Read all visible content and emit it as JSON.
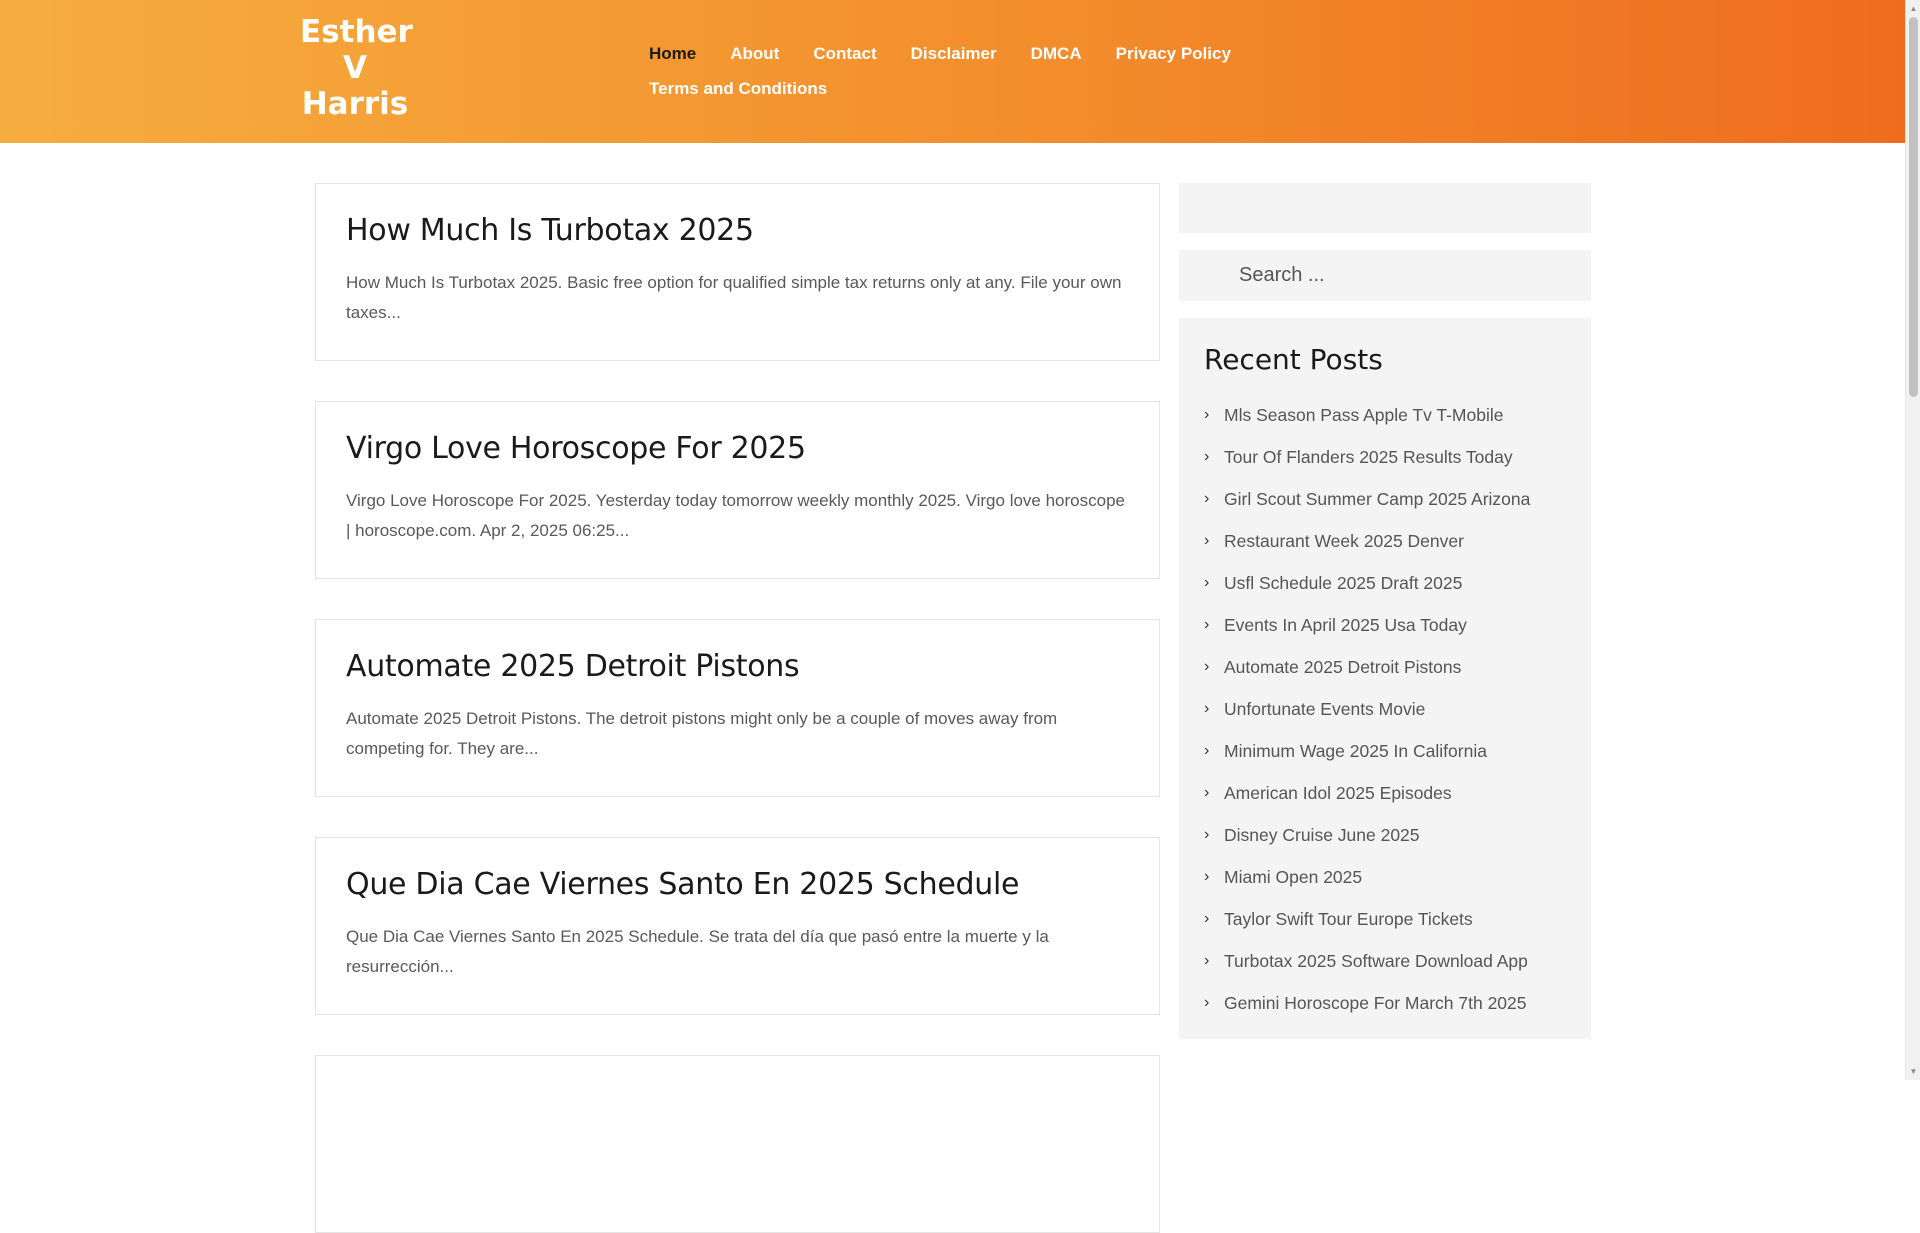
{
  "site": {
    "brand_lines": [
      "Esther",
      "V",
      "Harris"
    ]
  },
  "nav": {
    "row1": [
      "Home",
      "About",
      "Contact",
      "Disclaimer",
      "DMCA",
      "Privacy Policy"
    ],
    "row2": [
      "Terms and Conditions"
    ],
    "active": "Home"
  },
  "posts": [
    {
      "title": "How Much Is Turbotax 2025",
      "excerpt": "How Much Is Turbotax 2025. Basic free option for qualified simple tax returns only at any. File your own taxes..."
    },
    {
      "title": "Virgo Love Horoscope For 2025",
      "excerpt": "Virgo Love Horoscope For 2025. Yesterday today tomorrow weekly monthly 2025. Virgo love horoscope | horoscope.com. Apr 2, 2025 06:25..."
    },
    {
      "title": "Automate 2025 Detroit Pistons",
      "excerpt": "Automate 2025 Detroit Pistons. The detroit pistons might only be a couple of moves away from competing for. They are..."
    },
    {
      "title": "Que Dia Cae Viernes Santo En 2025 Schedule",
      "excerpt": "Que Dia Cae Viernes Santo En 2025 Schedule. Se trata del día que pasó entre la muerte y la resurrección..."
    }
  ],
  "search": {
    "placeholder": "Search ..."
  },
  "recent_posts": {
    "title": "Recent Posts",
    "items": [
      "Mls Season Pass Apple Tv T-Mobile",
      "Tour Of Flanders 2025 Results Today",
      "Girl Scout Summer Camp 2025 Arizona",
      "Restaurant Week 2025 Denver",
      "Usfl Schedule 2025 Draft 2025",
      "Events In April 2025 Usa Today",
      "Automate 2025 Detroit Pistons",
      "Unfortunate Events Movie",
      "Minimum Wage 2025 In California",
      "American Idol 2025 Episodes",
      "Disney Cruise June 2025",
      "Miami Open 2025",
      "Taylor Swift Tour Europe Tickets",
      "Turbotax 2025 Software Download App",
      "Gemini Horoscope For March 7th 2025"
    ]
  },
  "icons": {
    "recent_bullet": "chevron-right-icon",
    "scroll_up": "arrow-up-icon",
    "scroll_down": "arrow-down-icon"
  },
  "colors": {
    "header_gradient_start": "#f6ad3f",
    "header_gradient_end": "#ef6c1f",
    "nav_active": "#1a1a1a",
    "widget_bg": "#f4f4f4"
  }
}
